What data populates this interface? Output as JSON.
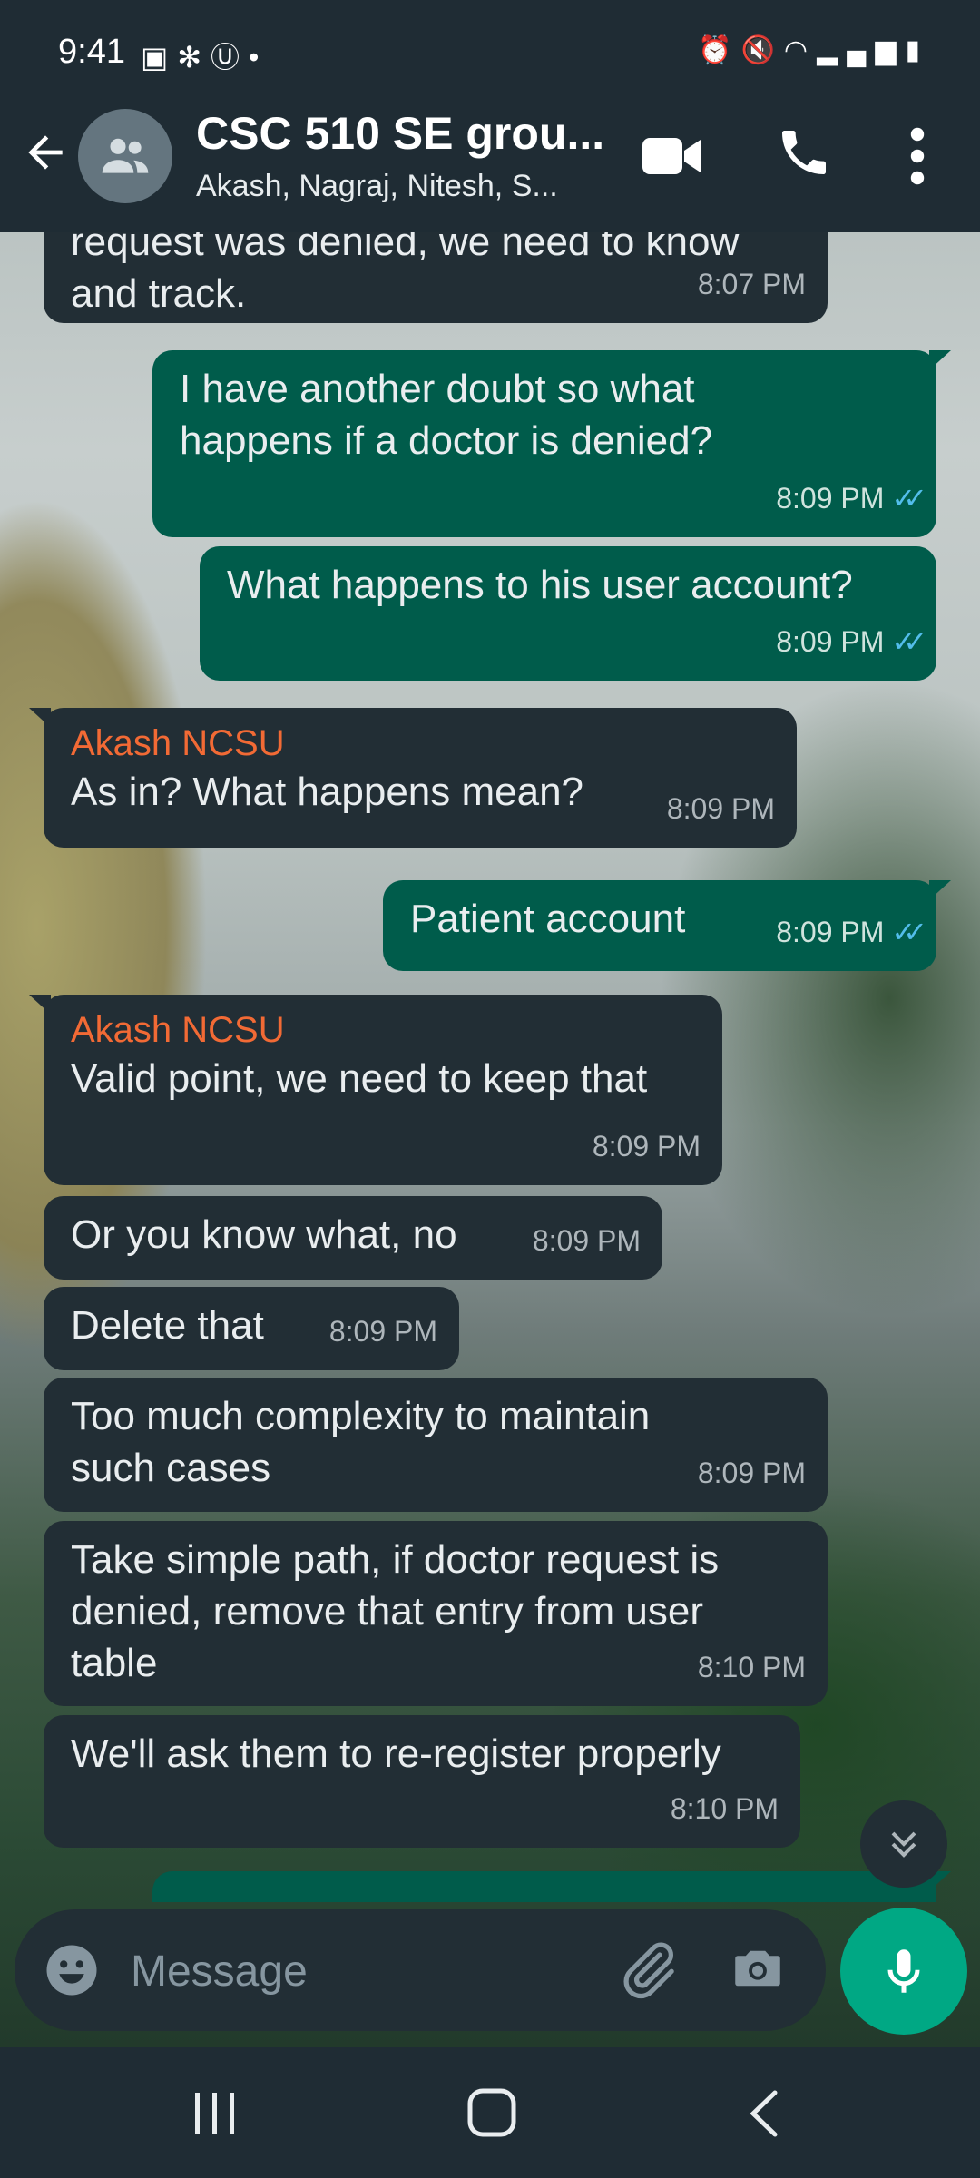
{
  "status_bar": {
    "time": "9:41",
    "left_icons": [
      "gallery-icon",
      "pinwheel-icon",
      "u-app-icon",
      "dot-icon"
    ],
    "right_icons": [
      "alarm-icon",
      "mute-icon",
      "wifi-icon",
      "signal-icon",
      "battery-icon"
    ]
  },
  "header": {
    "title": "CSC 510 SE grou...",
    "subtitle": "Akash, Nagraj, Nitesh, S..."
  },
  "messages": [
    {
      "dir": "in",
      "sender": "",
      "text": "request was denied, we need to know\nand track.",
      "time": "8:07 PM",
      "ticks": ""
    },
    {
      "dir": "out",
      "sender": "",
      "text": "I have another doubt so what\nhappens if a doctor is denied?",
      "time": "8:09 PM",
      "ticks": "✓✓"
    },
    {
      "dir": "out",
      "sender": "",
      "text": "What happens to his user account?",
      "time": "8:09 PM",
      "ticks": "✓✓"
    },
    {
      "dir": "in",
      "sender": "Akash NCSU",
      "text": "As in? What happens mean?",
      "time": "8:09 PM",
      "ticks": ""
    },
    {
      "dir": "out",
      "sender": "",
      "text": "Patient account",
      "time": "8:09 PM",
      "ticks": "✓✓"
    },
    {
      "dir": "in",
      "sender": "Akash NCSU",
      "text": "Valid point, we need to keep that",
      "time": "8:09 PM",
      "ticks": ""
    },
    {
      "dir": "in",
      "sender": "",
      "text": "Or you know what, no",
      "time": "8:09 PM",
      "ticks": ""
    },
    {
      "dir": "in",
      "sender": "",
      "text": "Delete that",
      "time": "8:09 PM",
      "ticks": ""
    },
    {
      "dir": "in",
      "sender": "",
      "text": "Too much complexity to maintain\nsuch cases",
      "time": "8:09 PM",
      "ticks": ""
    },
    {
      "dir": "in",
      "sender": "",
      "text": "Take simple path, if doctor request is\ndenied, remove that entry from user\ntable",
      "time": "8:10 PM",
      "ticks": ""
    },
    {
      "dir": "in",
      "sender": "",
      "text": "We'll ask them to re-register properly",
      "time": "8:10 PM",
      "ticks": ""
    }
  ],
  "composer": {
    "placeholder": "Message"
  },
  "colors": {
    "bar": "#1f2c34",
    "incoming_bubble": "#222e35",
    "outgoing_bubble": "#005c4b",
    "sender_name": "#f26a35",
    "read_ticks": "#53bdeb",
    "mic_button": "#00a884"
  }
}
